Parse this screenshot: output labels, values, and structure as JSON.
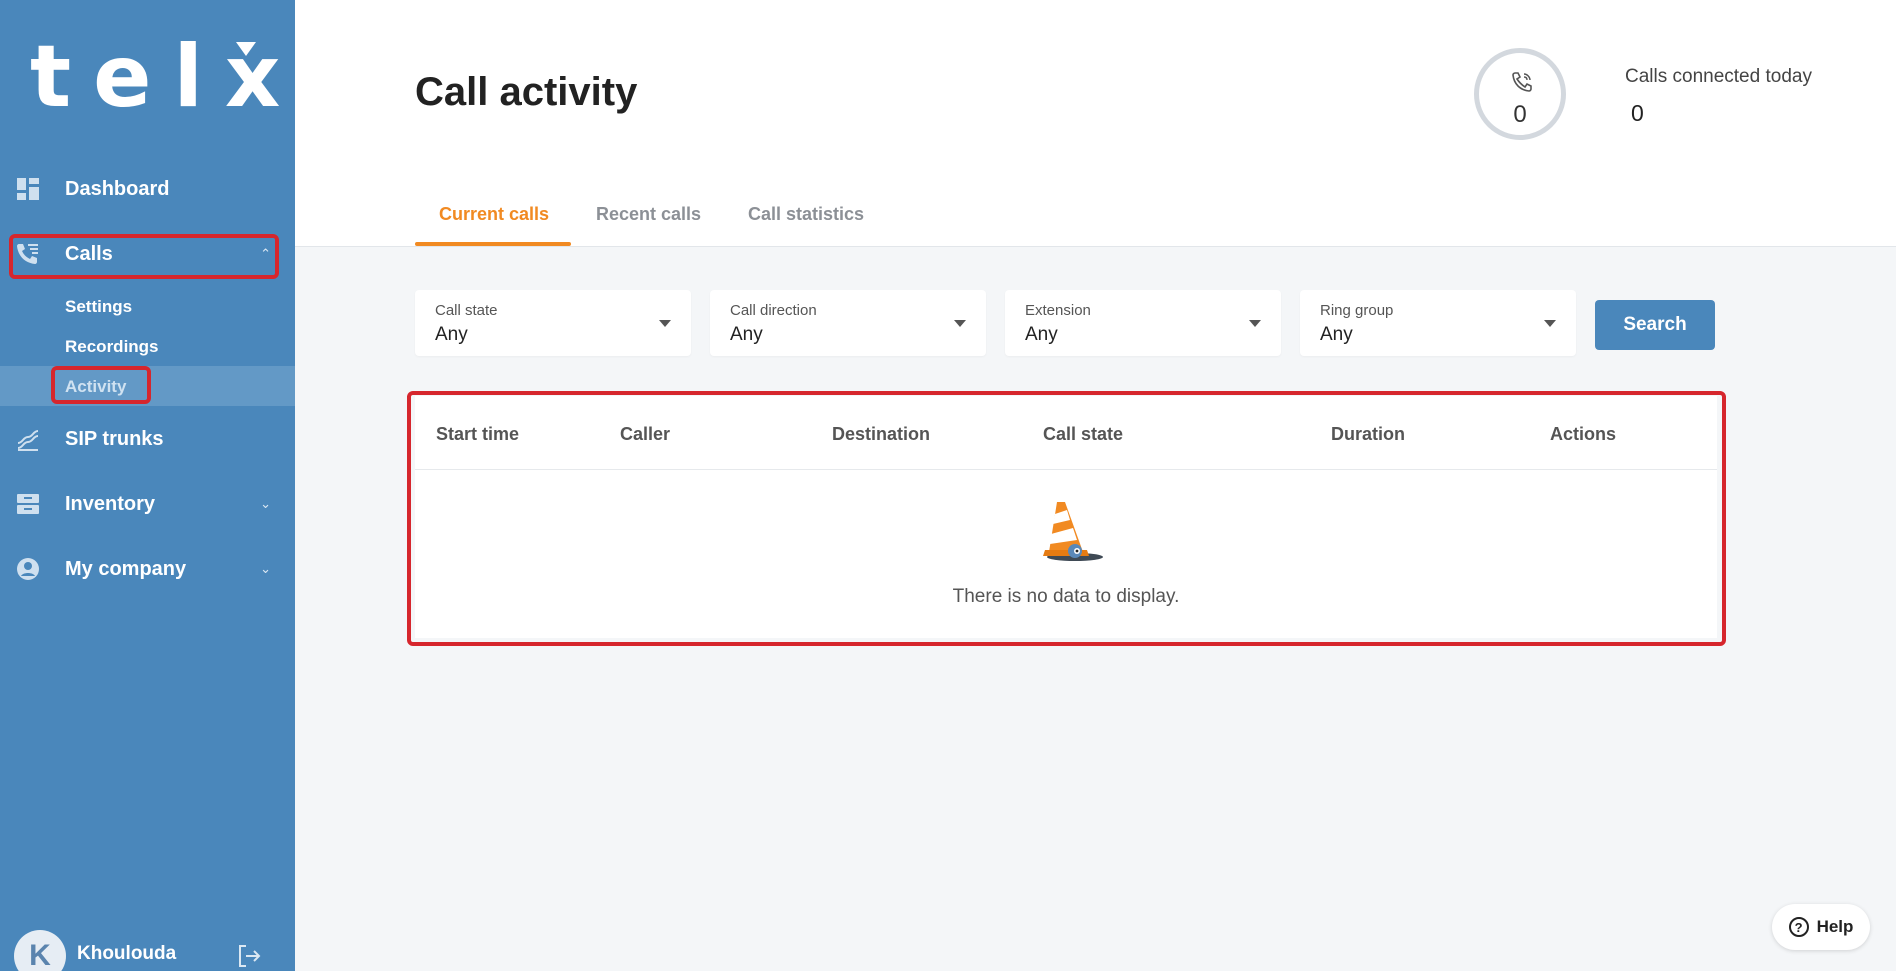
{
  "sidebar": {
    "logo": "telxi",
    "items": [
      {
        "label": "Dashboard",
        "icon": "dashboard-icon"
      },
      {
        "label": "Calls",
        "icon": "phone-list-icon",
        "expanded": true
      },
      {
        "label": "SIP trunks",
        "icon": "sip-trunks-icon"
      },
      {
        "label": "Inventory",
        "icon": "inventory-icon"
      },
      {
        "label": "My company",
        "icon": "company-icon"
      }
    ],
    "calls_sub": [
      "Settings",
      "Recordings",
      "Activity"
    ],
    "active_sub": "Activity",
    "user": {
      "initial": "K",
      "name": "Khoulouda"
    }
  },
  "header": {
    "title": "Call activity",
    "counter_value": "0",
    "calls_connected_label": "Calls connected today",
    "calls_connected_value": "0"
  },
  "tabs": [
    {
      "label": "Current calls",
      "active": true
    },
    {
      "label": "Recent calls",
      "active": false
    },
    {
      "label": "Call statistics",
      "active": false
    }
  ],
  "filters": [
    {
      "label": "Call state",
      "value": "Any"
    },
    {
      "label": "Call direction",
      "value": "Any"
    },
    {
      "label": "Extension",
      "value": "Any"
    },
    {
      "label": "Ring group",
      "value": "Any"
    }
  ],
  "search_label": "Search",
  "table": {
    "columns": [
      "Start time",
      "Caller",
      "Destination",
      "Call state",
      "Duration",
      "Actions"
    ],
    "empty_text": "There is no data to display."
  },
  "help_label": "Help",
  "colors": {
    "sidebar": "#4a87bb",
    "accent": "#f18a22",
    "highlight": "#d6262d"
  }
}
